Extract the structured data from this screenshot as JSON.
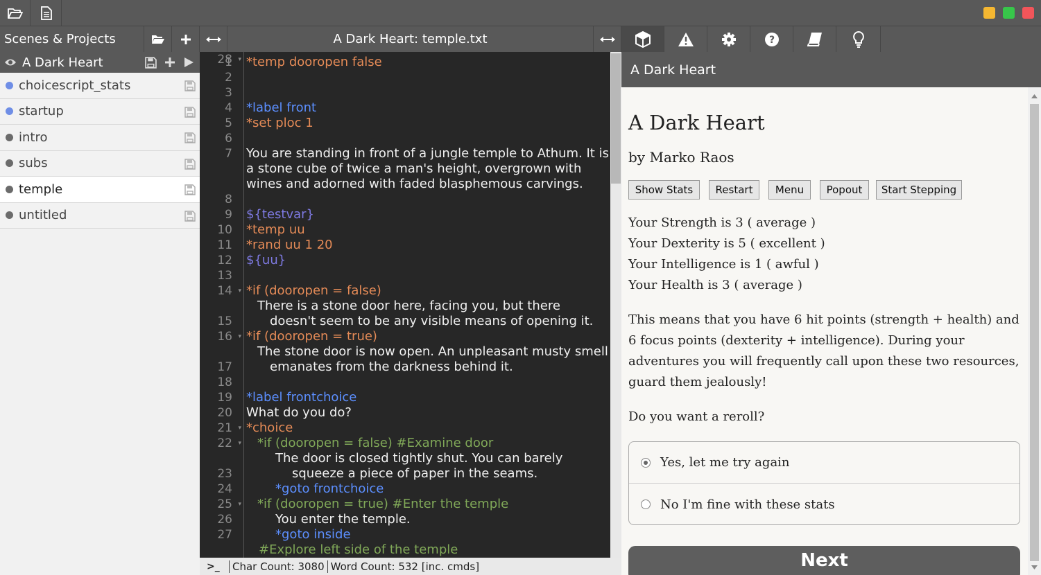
{
  "window": {
    "controls": {
      "minimize_color": "#f5b731",
      "maximize_color": "#37c64a",
      "close_color": "#f2555a"
    }
  },
  "header": {
    "scenes_label": "Scenes & Projects",
    "editor_title": "A Dark Heart: temple.txt"
  },
  "sidebar": {
    "project": {
      "name": "A Dark Heart"
    },
    "scenes": [
      {
        "name": "choicescript_stats",
        "dot": "#6f8ee6",
        "active": false
      },
      {
        "name": "startup",
        "dot": "#6f8ee6",
        "active": false
      },
      {
        "name": "intro",
        "dot": "#6b6b6b",
        "active": false
      },
      {
        "name": "subs",
        "dot": "#6b6b6b",
        "active": false
      },
      {
        "name": "temple",
        "dot": "#6b6b6b",
        "active": true
      },
      {
        "name": "untitled",
        "dot": "#6b6b6b",
        "active": false
      }
    ]
  },
  "editor": {
    "line_numbers": [
      "1",
      "2",
      "3",
      "4",
      "5",
      "6",
      "7",
      "8",
      "9",
      "10",
      "11",
      "12",
      "13",
      "14",
      "15",
      "16",
      "17",
      "18",
      "19",
      "20",
      "21",
      "22",
      "23",
      "24",
      "25",
      "26",
      "27",
      "28"
    ],
    "code": {
      "l1": "*temp dooropen false",
      "l4": "*label front",
      "l5": "*set ploc 1",
      "l7a": "You are standing in front of a jungle temple to Athum. It is",
      "l7b": "a stone cube of twice a man's height, overgrown with",
      "l7c": "wines and adorned with faded blasphemous carvings.",
      "l9": "${testvar}",
      "l10": "*temp uu",
      "l11": "*rand uu 1 20",
      "l12": "${uu}",
      "l14": "*if (dooropen = false)",
      "l15a": "There is a stone door here, facing you, but there",
      "l15b": "doesn't seem to be any visible means of opening it.",
      "l16": "*if (dooropen = true)",
      "l17a": "The stone door is now open. An unpleasant musty smell",
      "l17b": "emanates from the darkness behind it.",
      "l19": "*label frontchoice",
      "l20": "What do you do?",
      "l21": "*choice",
      "l22": "*if (dooropen = false) #Examine door",
      "l23a": "The door is closed tightly shut. You can barely",
      "l23b": "squeeze a piece of paper in the seams.",
      "l24": "*goto frontchoice",
      "l25": "*if (dooropen = true) #Enter the temple",
      "l26": "You enter the temple.",
      "l27": "*goto inside",
      "l28": "#Explore left side of the temple"
    }
  },
  "statusbar": {
    "prompt": ">_",
    "char_count": "Char Count: 3080",
    "word_count": "Word Count: 532 [inc. cmds]"
  },
  "game": {
    "panel_title": "A Dark Heart",
    "title": "A Dark Heart",
    "author": "by Marko Raos",
    "buttons": [
      "Show Stats",
      "Restart",
      "Menu",
      "Popout",
      "Start Stepping"
    ],
    "stats": [
      "Your Strength is 3 ( average )",
      "Your Dexterity is 5 ( excellent )",
      "Your Intelligence is 1 ( awful )",
      "Your Health is 3 ( average )"
    ],
    "paragraph": "This means that you have 6 hit points (strength + health) and 6 focus points (dexterity + intelligence). During your adventures you will frequently call upon these two resources, guard them jealously!",
    "question": "Do you want a reroll?",
    "options": [
      {
        "label": "Yes, let me try again",
        "selected": true
      },
      {
        "label": "No I'm fine with these stats",
        "selected": false
      }
    ],
    "next_label": "Next"
  }
}
